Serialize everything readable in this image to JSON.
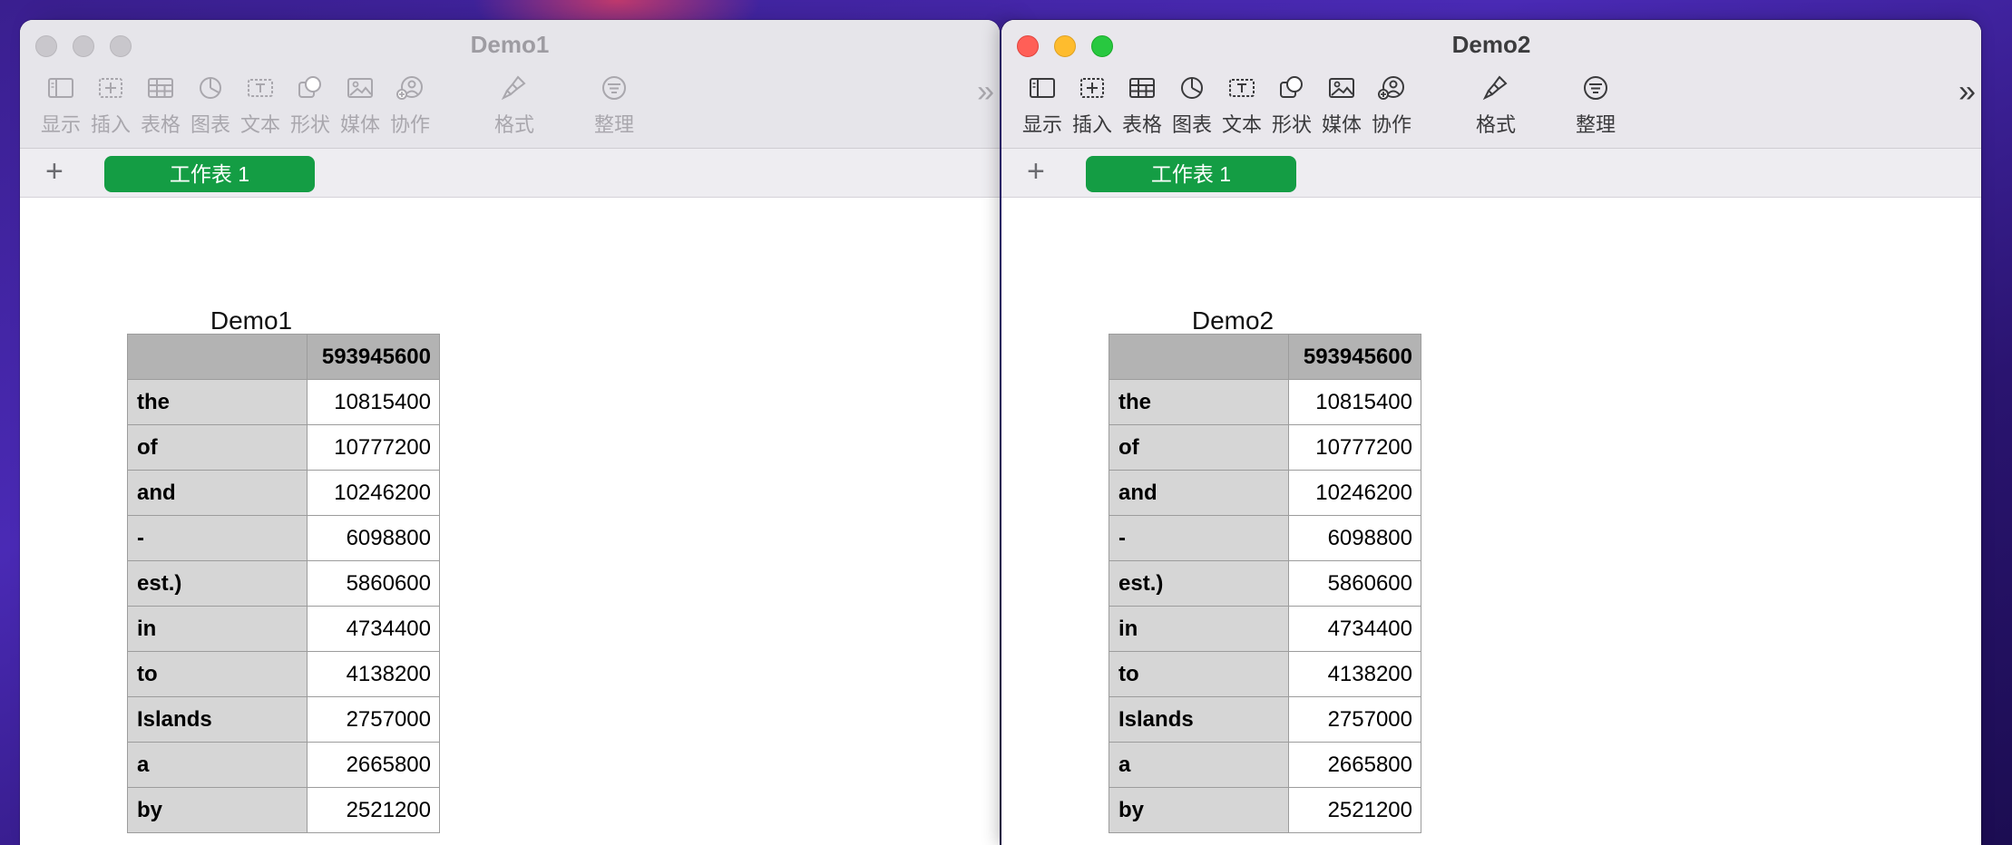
{
  "windows": [
    {
      "title": "Demo1",
      "toolbar": [
        {
          "label": "显示",
          "icon": "sidebar-icon"
        },
        {
          "label": "插入",
          "icon": "insert-icon"
        },
        {
          "label": "表格",
          "icon": "table-icon"
        },
        {
          "label": "图表",
          "icon": "chart-icon"
        },
        {
          "label": "文本",
          "icon": "text-icon"
        },
        {
          "label": "形状",
          "icon": "shape-icon"
        },
        {
          "label": "媒体",
          "icon": "media-icon"
        },
        {
          "label": "协作",
          "icon": "collaborate-icon"
        },
        {
          "label": "格式",
          "icon": "format-brush-icon"
        },
        {
          "label": "整理",
          "icon": "organize-icon"
        }
      ],
      "more_label": "»",
      "add_sheet": "+",
      "sheet_tab": "工作表 1",
      "table_title": "Demo1",
      "header_value": "593945600",
      "rows": [
        {
          "label": "the",
          "value": "10815400"
        },
        {
          "label": "of",
          "value": "10777200"
        },
        {
          "label": "and",
          "value": "10246200"
        },
        {
          "label": "-",
          "value": "6098800"
        },
        {
          "label": "est.)",
          "value": "5860600"
        },
        {
          "label": "in",
          "value": "4734400"
        },
        {
          "label": "to",
          "value": "4138200"
        },
        {
          "label": "Islands",
          "value": "2757000"
        },
        {
          "label": "a",
          "value": "2665800"
        },
        {
          "label": "by",
          "value": "2521200"
        }
      ]
    },
    {
      "title": "Demo2",
      "toolbar": [
        {
          "label": "显示",
          "icon": "sidebar-icon"
        },
        {
          "label": "插入",
          "icon": "insert-icon"
        },
        {
          "label": "表格",
          "icon": "table-icon"
        },
        {
          "label": "图表",
          "icon": "chart-icon"
        },
        {
          "label": "文本",
          "icon": "text-icon"
        },
        {
          "label": "形状",
          "icon": "shape-icon"
        },
        {
          "label": "媒体",
          "icon": "media-icon"
        },
        {
          "label": "协作",
          "icon": "collaborate-icon"
        },
        {
          "label": "格式",
          "icon": "format-brush-icon"
        },
        {
          "label": "整理",
          "icon": "organize-icon"
        }
      ],
      "more_label": "»",
      "add_sheet": "+",
      "sheet_tab": "工作表 1",
      "table_title": "Demo2",
      "header_value": "593945600",
      "rows": [
        {
          "label": "the",
          "value": "10815400"
        },
        {
          "label": "of",
          "value": "10777200"
        },
        {
          "label": "and",
          "value": "10246200"
        },
        {
          "label": "-",
          "value": "6098800"
        },
        {
          "label": "est.)",
          "value": "5860600"
        },
        {
          "label": "in",
          "value": "4734400"
        },
        {
          "label": "to",
          "value": "4138200"
        },
        {
          "label": "Islands",
          "value": "2757000"
        },
        {
          "label": "a",
          "value": "2665800"
        },
        {
          "label": "by",
          "value": "2521200"
        }
      ]
    }
  ],
  "colors": {
    "sheet_tab": "#149d44",
    "close": "#ff5f57",
    "minimize": "#febc2e",
    "maximize": "#28c840",
    "header_cell": "#b3b3b3",
    "label_cell": "#d6d6d6"
  }
}
